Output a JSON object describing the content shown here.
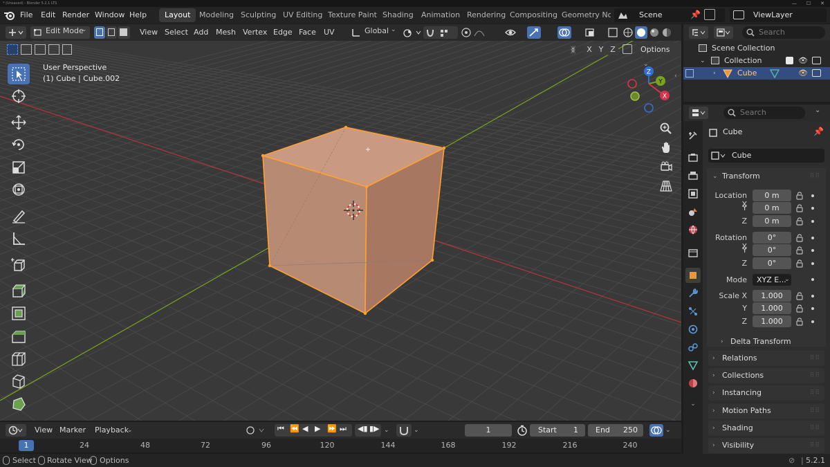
{
  "window": {
    "title": "* (Unsaved) - Blender 5.2.1 LTS"
  },
  "menu": [
    "File",
    "Edit",
    "Render",
    "Window",
    "Help"
  ],
  "workspaces": [
    "Layout",
    "Modeling",
    "Sculpting",
    "UV Editing",
    "Texture Paint",
    "Shading",
    "Animation",
    "Rendering",
    "Compositing",
    "Geometry Nodes"
  ],
  "scene": {
    "label": "Scene",
    "view_layer": "ViewLayer"
  },
  "viewport_header": {
    "mode": "Edit Mode",
    "menus": [
      "View",
      "Select",
      "Add",
      "Mesh",
      "Vertex",
      "Edge",
      "Face",
      "UV"
    ],
    "orientation": "Global",
    "axes": [
      "X",
      "Y",
      "Z"
    ],
    "options": "Options"
  },
  "viewport": {
    "perspective": "User Perspective",
    "object_info": "(1) Cube | Cube.002",
    "gizmo_axes": [
      "X",
      "Y",
      "Z"
    ]
  },
  "outliner": {
    "search_placeholder": "Search",
    "rows": [
      {
        "label": "Scene Collection"
      },
      {
        "label": "Collection"
      },
      {
        "label": "Cube"
      }
    ]
  },
  "properties": {
    "search_placeholder": "Search",
    "object_name": "Cube",
    "data_name": "Cube",
    "transform_title": "Transform",
    "location_label": "Location X",
    "rotation_label": "Rotation X",
    "scale_label": "Scale X",
    "y_label": "Y",
    "z_label": "Z",
    "location": [
      "0 m",
      "0 m",
      "0 m"
    ],
    "rotation": [
      "0°",
      "0°",
      "0°"
    ],
    "mode_label": "Mode",
    "mode_value": "XYZ E...",
    "scale": [
      "1.000",
      "1.000",
      "1.000"
    ],
    "delta_transform": "Delta Transform",
    "panels": [
      "Relations",
      "Collections",
      "Instancing",
      "Motion Paths",
      "Shading",
      "Visibility"
    ]
  },
  "timeline": {
    "menus": [
      "View",
      "Marker",
      "Playback"
    ],
    "current_frame": "1",
    "start_label": "Start",
    "start": "1",
    "end_label": "End",
    "end": "250",
    "ruler": [
      "1",
      "24",
      "48",
      "72",
      "96",
      "120",
      "144",
      "168",
      "192",
      "216",
      "240"
    ]
  },
  "status": {
    "select": "Select",
    "rotate_view": "Rotate View",
    "options": "Options",
    "version": "5.2.1"
  },
  "colors": {
    "accent": "#4772b3",
    "selected_edge": "#ffa033",
    "x_axis": "#b9323c",
    "y_axis": "#7aa31e"
  }
}
